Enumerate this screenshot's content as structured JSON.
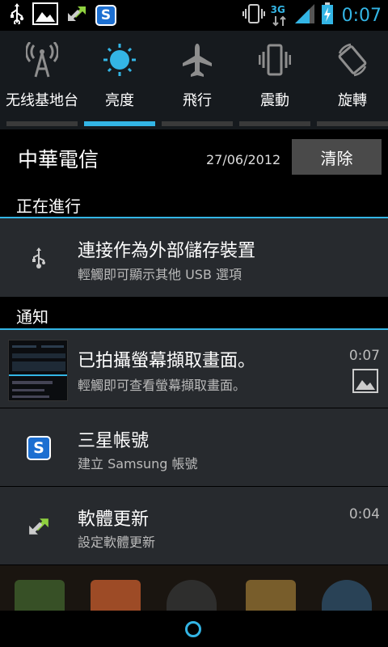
{
  "status_bar": {
    "left_icons": [
      "usb-icon",
      "picture-icon",
      "update-arrows-icon",
      "samsung-account-icon"
    ],
    "samsung_letter": "S",
    "network_type": "3G",
    "time": "0:07",
    "accent_color": "#33b5e5"
  },
  "quick_settings": {
    "items": [
      {
        "label": "无线基地台",
        "icon": "hotspot-icon",
        "active": false
      },
      {
        "label": "亮度",
        "icon": "brightness-icon",
        "active": true
      },
      {
        "label": "飛行",
        "icon": "airplane-icon",
        "active": false
      },
      {
        "label": "震動",
        "icon": "vibrate-icon",
        "active": false
      },
      {
        "label": "旋轉",
        "icon": "rotate-icon",
        "active": false
      }
    ]
  },
  "header": {
    "carrier": "中華電信",
    "date": "27/06/2012",
    "clear_label": "清除"
  },
  "sections": {
    "ongoing": "正在進行",
    "notifications": "通知"
  },
  "ongoing": [
    {
      "title": "連接作為外部儲存裝置",
      "subtitle": "輕觸即可顯示其他 USB 選項",
      "icon": "usb-icon"
    }
  ],
  "notifications": [
    {
      "title": "已拍攝螢幕擷取畫面。",
      "subtitle": "輕觸即可查看螢幕擷取畫面。",
      "time": "0:07",
      "icon": "screenshot-thumbnail",
      "right_icon": "picture-icon"
    },
    {
      "title": "三星帳號",
      "subtitle": "建立 Samsung 帳號",
      "time": "",
      "icon": "samsung-account-icon"
    },
    {
      "title": "軟體更新",
      "subtitle": "設定軟體更新",
      "time": "0:04",
      "icon": "update-arrows-icon"
    }
  ]
}
